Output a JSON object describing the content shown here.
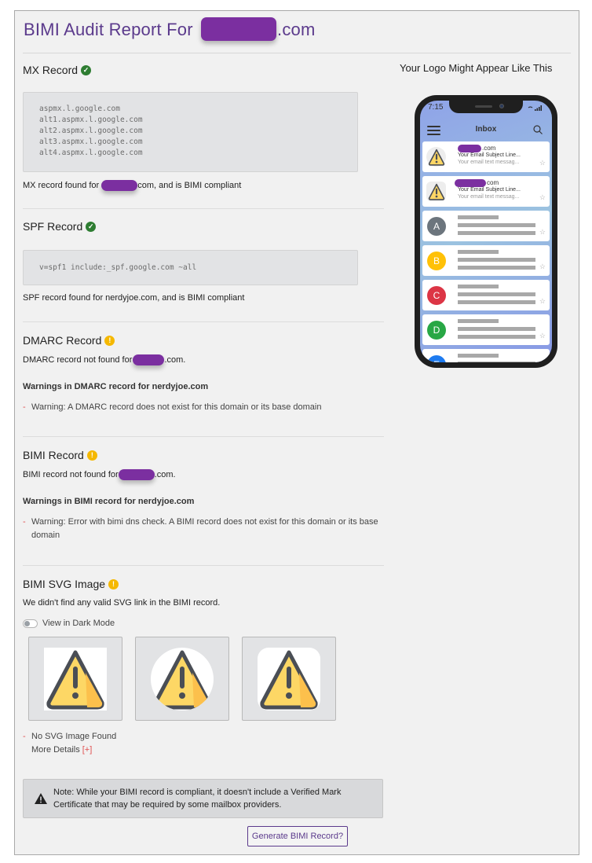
{
  "report": {
    "title_prefix": "BIMI Audit Report For ",
    "title_suffix": ".com"
  },
  "mx": {
    "title": "MX Record",
    "status": "ok",
    "records": [
      "aspmx.l.google.com",
      "alt1.aspmx.l.google.com",
      "alt2.aspmx.l.google.com",
      "alt3.aspmx.l.google.com",
      "alt4.aspmx.l.google.com"
    ],
    "message_prefix": "MX record found for ",
    "message_suffix": "com, and is BIMI compliant"
  },
  "spf": {
    "title": "SPF Record",
    "status": "ok",
    "record": "v=spf1 include:_spf.google.com ~all",
    "message": "SPF record found for nerdyjoe.com, and is BIMI compliant"
  },
  "dmarc": {
    "title": "DMARC Record",
    "status": "warning",
    "message_prefix": "DMARC record not found for ",
    "message_suffix": ".com.",
    "warnings_heading": "Warnings in DMARC record for nerdyjoe.com",
    "warnings": [
      "Warning: A DMARC record does not exist for this domain or its base domain"
    ]
  },
  "bimi": {
    "title": "BIMI Record",
    "status": "warning",
    "message_prefix": "BIMI record not found for",
    "message_suffix": ".com.",
    "warnings_heading": "Warnings in BIMI record for nerdyjoe.com",
    "warnings": [
      "Warning: Error with bimi dns check. A BIMI record does not exist for this domain or its base domain"
    ]
  },
  "svg": {
    "title": "BIMI SVG Image",
    "status": "warning",
    "message": "We didn't find any valid SVG link in the BIMI record.",
    "dark_mode_label": "View in Dark Mode",
    "dark_mode_on": false,
    "previews": [
      "square",
      "circle",
      "rounded"
    ],
    "errors": [
      "No SVG Image Found"
    ],
    "more_details_label": "More Details ",
    "more_details_toggle": "[+]"
  },
  "note": {
    "text": "Note: While your BIMI record is compliant, it doesn't include a Verified Mark Certificate that may be required by some mailbox providers."
  },
  "generate_button": "Generate BIMI Record?",
  "preview_panel": {
    "title": "Your Logo Might Appear Like This",
    "phone": {
      "time": "7:15",
      "signal": "≈ .∥l",
      "inbox_label": "Inbox",
      "branded_mails": [
        {
          "sender_suffix": ".com",
          "subject": "Your Email Subject Line...",
          "preview": "Your email text messag..."
        },
        {
          "sender_suffix": "com",
          "subject": "Your Email Subject Line...",
          "preview": "Your email text messag..."
        }
      ],
      "placeholder_mails": [
        {
          "letter": "A",
          "color": "#6c757d"
        },
        {
          "letter": "B",
          "color": "#ffc107"
        },
        {
          "letter": "C",
          "color": "#dc3545"
        },
        {
          "letter": "D",
          "color": "#28a745"
        },
        {
          "letter": "E",
          "color": "#1e7bf0"
        }
      ]
    }
  },
  "colors": {
    "brand": "#5b3a8c",
    "ok": "#2e7d32",
    "warning": "#f5b800",
    "redaction": "#7b2fa0",
    "error_dash": "#e05050"
  }
}
